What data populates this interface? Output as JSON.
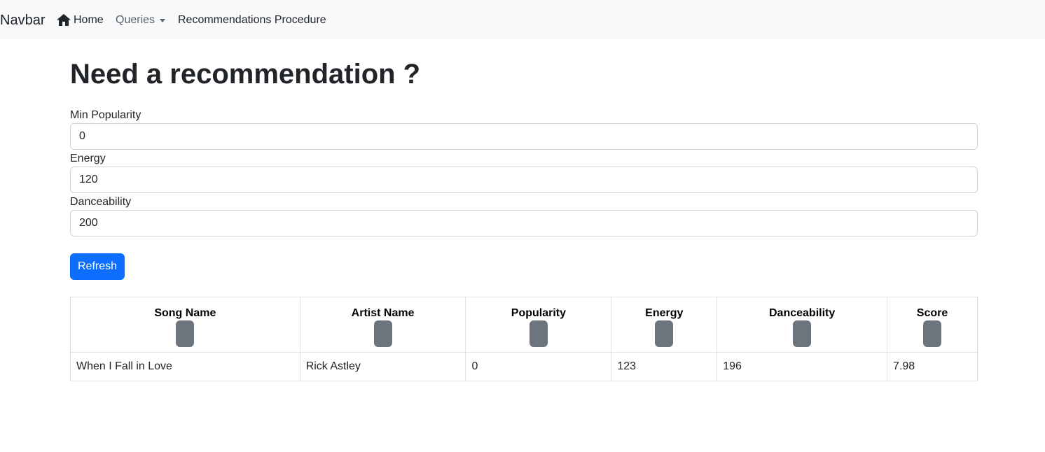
{
  "navbar": {
    "brand": "Navbar",
    "home_label": "Home",
    "queries_label": "Queries",
    "procedure_label": "Recommendations Procedure"
  },
  "page": {
    "title": "Need a recommendation ?"
  },
  "form": {
    "min_popularity": {
      "label": "Min Popularity",
      "value": "0"
    },
    "energy": {
      "label": "Energy",
      "value": "120"
    },
    "danceability": {
      "label": "Danceability",
      "value": "200"
    },
    "refresh_label": "Refresh"
  },
  "table": {
    "headers": [
      "Song Name",
      "Artist Name",
      "Popularity",
      "Energy",
      "Danceability",
      "Score"
    ],
    "rows": [
      [
        "When I Fall in Love",
        "Rick Astley",
        "0",
        "123",
        "196",
        "7.98"
      ]
    ]
  },
  "colors": {
    "primary": "#0d6efd",
    "sort_button": "#6c757d",
    "navbar_bg": "#f8f9fa"
  }
}
